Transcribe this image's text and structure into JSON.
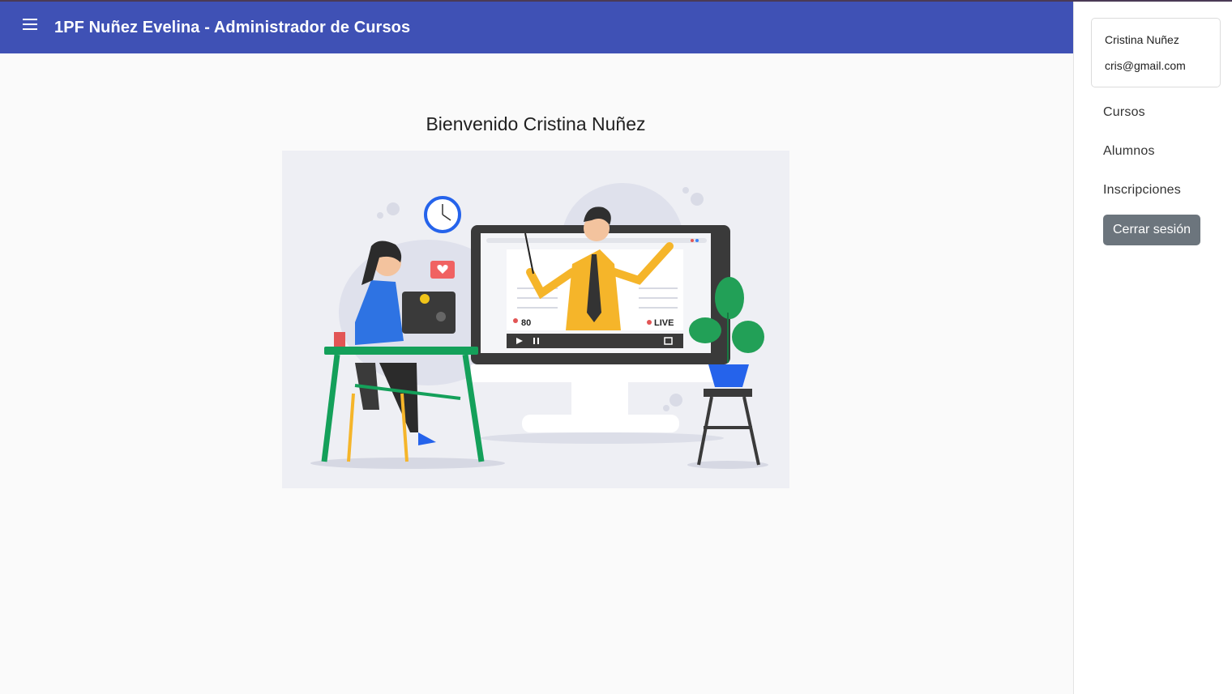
{
  "toolbar": {
    "title": "1PF Nuñez Evelina - Administrador de Cursos",
    "color": "#3f51b5"
  },
  "main": {
    "welcome": "Bienvenido Cristina Nuñez",
    "illustration": {
      "viewer_count": "80",
      "live_label": "LIVE"
    }
  },
  "sidenav": {
    "user": {
      "name": "Cristina Nuñez",
      "email": "cris@gmail.com"
    },
    "items": [
      {
        "label": "Cursos"
      },
      {
        "label": "Alumnos"
      },
      {
        "label": "Inscripciones"
      }
    ],
    "logout_label": "Cerrar sesión",
    "logout_color": "#6c757d"
  }
}
